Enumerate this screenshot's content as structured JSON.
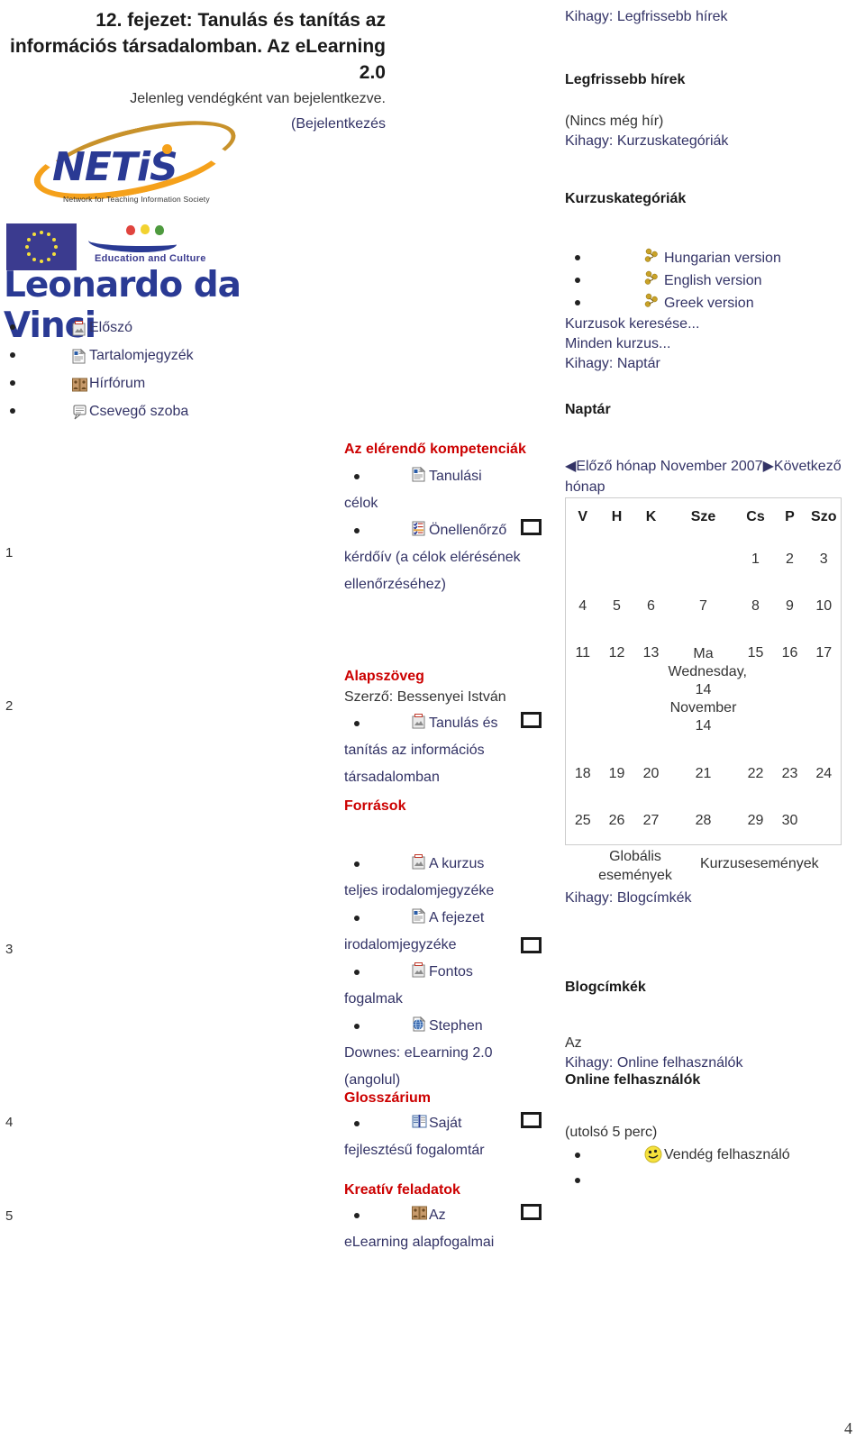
{
  "header": {
    "title": "12. fejezet: Tanulás és tanítás az információs társadalomban. Az eLearning 2.0",
    "login_status": "Jelenleg vendégként van bejelentkezve.",
    "login_link": "(Bejelentkezés"
  },
  "brand": {
    "netis_word": "NETiS",
    "netis_tagline": "Network for Teaching Information Society",
    "eu_programme_label": "Education and Culture",
    "leonardo_word": "Leonardo da Vinci"
  },
  "left_nav": {
    "items": [
      {
        "label": "Előszó",
        "icon": "pdf-document-icon"
      },
      {
        "label": "Tartalomjegyzék",
        "icon": "text-document-icon"
      },
      {
        "label": "Hírfórum",
        "icon": "forum-icon"
      },
      {
        "label": "Csevegő szoba",
        "icon": "chat-icon"
      }
    ]
  },
  "line_numbers": [
    "1",
    "2",
    "3",
    "4",
    "5"
  ],
  "main": {
    "sections": [
      {
        "heading": "Az elérendő kompetenciák",
        "items": [
          {
            "icon": "text-document-icon",
            "label": "Tanulási",
            "tail": "célok",
            "checkbox": false
          },
          {
            "icon": "quiz-icon",
            "label": "Önellenőrző",
            "tail": "kérdőív (a célok elérésének ellenőrzéséhez)",
            "checkbox": true
          }
        ]
      },
      {
        "heading": "Alapszöveg",
        "author": "Szerző: Bessenyei István",
        "items": [
          {
            "icon": "pdf-document-icon",
            "label": "Tanulás és",
            "tail": "tanítás az információs társadalomban",
            "checkbox": true
          }
        ]
      },
      {
        "heading": "Források",
        "items": [
          {
            "icon": "pdf-document-icon",
            "label": "A kurzus",
            "tail": "teljes irodalomjegyzéke",
            "checkbox": false
          },
          {
            "icon": "text-document-icon",
            "label": "A fejezet",
            "tail": "irodalomjegyzéke",
            "checkbox": true
          },
          {
            "icon": "pdf-document-icon",
            "label": "Fontos",
            "tail": "fogalmak",
            "checkbox": false
          },
          {
            "icon": "web-link-icon",
            "label": "Stephen",
            "tail": "Downes: eLearning 2.0 (angolul)",
            "checkbox": false
          }
        ]
      },
      {
        "heading": "Glosszárium",
        "items": [
          {
            "icon": "glossary-icon",
            "label": "Saját",
            "tail": "fejlesztésű fogalomtár",
            "checkbox": true
          }
        ]
      },
      {
        "heading": "Kreatív feladatok",
        "items": [
          {
            "icon": "forum-icon",
            "label": "Az",
            "tail": "eLearning alapfogalmai",
            "checkbox": true
          }
        ]
      }
    ]
  },
  "sidebar": {
    "news": {
      "skip": "Kihagy: Legfrissebb hírek",
      "title": "Legfrissebb hírek",
      "empty": "(Nincs még hír)"
    },
    "categories": {
      "skip": "Kihagy: Kurzuskategóriák",
      "title": "Kurzuskategóriák",
      "items": [
        {
          "label": "Hungarian version",
          "icon": "folder-flower-icon"
        },
        {
          "label": "English version",
          "icon": "folder-flower-icon"
        },
        {
          "label": "Greek version",
          "icon": "folder-flower-icon"
        }
      ],
      "search_link": "Kurzusok keresése...",
      "all_link": "Minden kurzus..."
    },
    "calendar": {
      "skip": "Kihagy: Naptár",
      "title": "Naptár",
      "prev_label": "Előző hónap",
      "month_year": "November 2007",
      "next_label": "Következő hónap",
      "weekday_headers": [
        "V",
        "H",
        "K",
        "Sze",
        "Cs",
        "P",
        "Szo"
      ],
      "weeks": [
        [
          "",
          "",
          "",
          "",
          "1",
          "2",
          "3"
        ],
        [
          "4",
          "5",
          "6",
          "7",
          "8",
          "9",
          "10"
        ],
        [
          "11",
          "12",
          "13",
          "TODAY",
          "15",
          "16",
          "17"
        ],
        [
          "18",
          "19",
          "20",
          "21",
          "22",
          "23",
          "24"
        ],
        [
          "25",
          "26",
          "27",
          "28",
          "29",
          "30",
          ""
        ]
      ],
      "today_cell": "Ma Wednesday, 14 November 14",
      "legend_global": "Globális események",
      "legend_course": "Kurzusesemények"
    },
    "blog": {
      "skip": "Kihagy: Blogcímkék",
      "title": "Blogcímkék",
      "tag": "Az"
    },
    "online": {
      "skip": "Kihagy: Online felhasználók",
      "title": "Online felhasználók",
      "subtitle": "(utolsó 5 perc)",
      "users": [
        {
          "label": "Vendég felhasználó",
          "icon": "smiley-avatar-icon"
        },
        {
          "label": "",
          "icon": ""
        }
      ]
    }
  },
  "footer": {
    "page_number": "4"
  },
  "colors": {
    "link": "#333366",
    "heading_red": "#cc0000",
    "brand_blue": "#2A3A94",
    "brand_orange": "#F5A11B"
  }
}
